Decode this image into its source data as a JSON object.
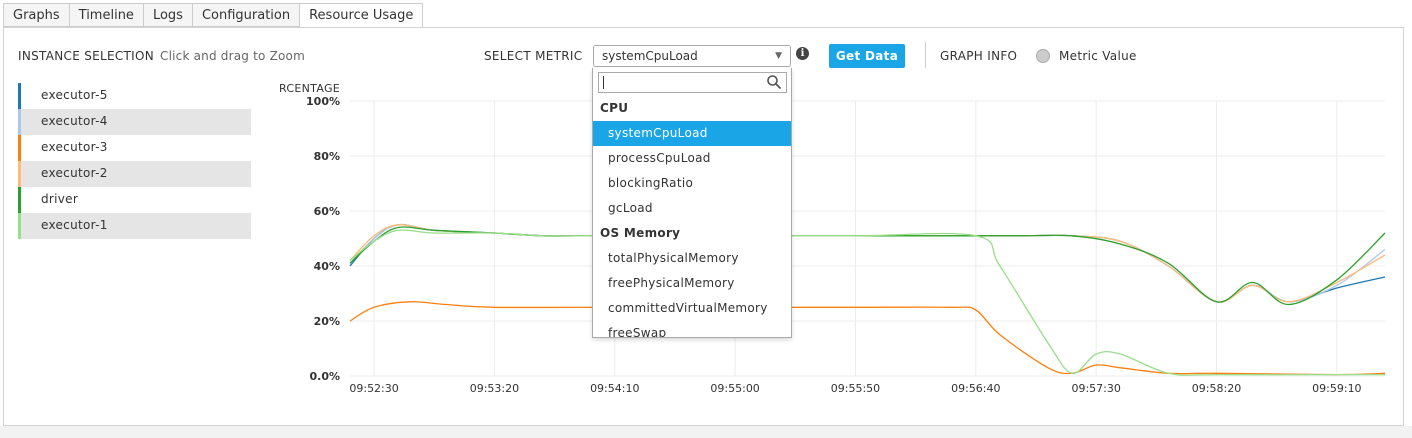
{
  "tabs": [
    {
      "label": "Graphs"
    },
    {
      "label": "Timeline"
    },
    {
      "label": "Logs"
    },
    {
      "label": "Configuration"
    },
    {
      "label": "Resource Usage",
      "active": true
    }
  ],
  "header": {
    "instance_selection_label": "INSTANCE SELECTION",
    "zoom_hint": "Click and drag to Zoom",
    "select_metric_label": "SELECT METRIC",
    "selected_metric": "systemCpuLoad",
    "get_data_label": "Get Data",
    "graph_info_label": "GRAPH INFO",
    "metric_value_label": "Metric Value"
  },
  "instances": [
    {
      "name": "executor-5",
      "color": "#1f77b4",
      "shaded": false
    },
    {
      "name": "executor-4",
      "color": "#aec7e8",
      "shaded": true
    },
    {
      "name": "executor-3",
      "color": "#ff7f0e",
      "shaded": false
    },
    {
      "name": "executor-2",
      "color": "#ffbb78",
      "shaded": true
    },
    {
      "name": "driver",
      "color": "#2ca02c",
      "shaded": false
    },
    {
      "name": "executor-1",
      "color": "#98df8a",
      "shaded": true
    }
  ],
  "dropdown": {
    "search_value": "",
    "groups": [
      {
        "label": "CPU",
        "items": [
          "systemCpuLoad",
          "processCpuLoad",
          "blockingRatio",
          "gcLoad"
        ]
      },
      {
        "label": "OS Memory",
        "items": [
          "totalPhysicalMemory",
          "freePhysicalMemory",
          "committedVirtualMemory",
          "freeSwap"
        ]
      }
    ],
    "selected_item": "systemCpuLoad"
  },
  "chart_data": {
    "type": "line",
    "ylabel": "RCENTAGE",
    "y_ticks": [
      "0.0%",
      "20%",
      "40%",
      "60%",
      "80%",
      "100%"
    ],
    "ylim": [
      0,
      100
    ],
    "x_tick_labels": [
      "09:52:30",
      "09:53:20",
      "09:54:10",
      "09:55:00",
      "09:55:50",
      "09:56:40",
      "09:57:30",
      "09:58:20",
      "09:59:10"
    ],
    "x_start": "09:52:20",
    "x_end": "09:59:30",
    "grid": true,
    "series": [
      {
        "name": "executor-5",
        "color": "#1f77b4",
        "points": [
          [
            "09:52:20",
            40
          ],
          [
            "09:52:30",
            50
          ],
          [
            "09:52:40",
            55
          ],
          [
            "09:52:55",
            53
          ],
          [
            "09:53:20",
            52
          ],
          [
            "09:53:40",
            51
          ],
          [
            "09:54:00",
            51
          ],
          [
            "09:54:20",
            51
          ],
          [
            "09:55:00",
            51
          ],
          [
            "09:55:50",
            51
          ],
          [
            "09:56:40",
            51
          ],
          [
            "09:57:00",
            51
          ],
          [
            "09:57:20",
            51
          ],
          [
            "09:57:40",
            49
          ],
          [
            "09:58:00",
            40
          ],
          [
            "09:58:20",
            27
          ],
          [
            "09:58:35",
            33
          ],
          [
            "09:58:50",
            27
          ],
          [
            "09:59:10",
            32
          ],
          [
            "09:59:30",
            36
          ]
        ]
      },
      {
        "name": "executor-4",
        "color": "#aec7e8",
        "points": [
          [
            "09:52:20",
            41
          ],
          [
            "09:52:30",
            50
          ],
          [
            "09:52:40",
            55
          ],
          [
            "09:52:55",
            53
          ],
          [
            "09:53:20",
            52
          ],
          [
            "09:53:40",
            51
          ],
          [
            "09:54:00",
            51
          ],
          [
            "09:54:20",
            51
          ],
          [
            "09:55:00",
            51
          ],
          [
            "09:55:50",
            51
          ],
          [
            "09:56:40",
            51
          ],
          [
            "09:57:00",
            51
          ],
          [
            "09:57:20",
            51
          ],
          [
            "09:57:40",
            49
          ],
          [
            "09:58:00",
            40
          ],
          [
            "09:58:20",
            27
          ],
          [
            "09:58:35",
            33
          ],
          [
            "09:58:50",
            27
          ],
          [
            "09:59:10",
            33
          ],
          [
            "09:59:30",
            46
          ]
        ]
      },
      {
        "name": "executor-3",
        "color": "#ff7f0e",
        "points": [
          [
            "09:52:20",
            20
          ],
          [
            "09:52:30",
            25
          ],
          [
            "09:52:45",
            27
          ],
          [
            "09:53:00",
            26
          ],
          [
            "09:53:20",
            25
          ],
          [
            "09:54:10",
            25
          ],
          [
            "09:55:00",
            25
          ],
          [
            "09:55:50",
            25
          ],
          [
            "09:56:30",
            25
          ],
          [
            "09:56:40",
            24
          ],
          [
            "09:56:50",
            15
          ],
          [
            "09:57:10",
            3
          ],
          [
            "09:57:20",
            1
          ],
          [
            "09:57:30",
            4
          ],
          [
            "09:57:40",
            3
          ],
          [
            "09:58:00",
            1
          ],
          [
            "09:58:20",
            1
          ],
          [
            "09:59:10",
            0.5
          ],
          [
            "09:59:30",
            1
          ]
        ]
      },
      {
        "name": "executor-2",
        "color": "#ffbb78",
        "points": [
          [
            "09:52:20",
            42
          ],
          [
            "09:52:30",
            51
          ],
          [
            "09:52:40",
            55
          ],
          [
            "09:52:55",
            53
          ],
          [
            "09:53:20",
            52
          ],
          [
            "09:53:40",
            51
          ],
          [
            "09:54:00",
            51
          ],
          [
            "09:54:20",
            51
          ],
          [
            "09:55:00",
            51
          ],
          [
            "09:55:50",
            51
          ],
          [
            "09:56:40",
            51
          ],
          [
            "09:57:00",
            51
          ],
          [
            "09:57:20",
            51
          ],
          [
            "09:57:40",
            49
          ],
          [
            "09:58:00",
            40
          ],
          [
            "09:58:20",
            27
          ],
          [
            "09:58:35",
            33
          ],
          [
            "09:58:50",
            27
          ],
          [
            "09:59:10",
            34
          ],
          [
            "09:59:30",
            44
          ]
        ]
      },
      {
        "name": "driver",
        "color": "#2ca02c",
        "points": [
          [
            "09:52:20",
            41
          ],
          [
            "09:52:30",
            49
          ],
          [
            "09:52:40",
            54
          ],
          [
            "09:52:55",
            53
          ],
          [
            "09:53:20",
            52
          ],
          [
            "09:53:40",
            51
          ],
          [
            "09:54:00",
            51
          ],
          [
            "09:54:20",
            51
          ],
          [
            "09:55:00",
            51
          ],
          [
            "09:55:50",
            51
          ],
          [
            "09:56:40",
            51
          ],
          [
            "09:57:00",
            51
          ],
          [
            "09:57:20",
            51
          ],
          [
            "09:57:40",
            48
          ],
          [
            "09:58:00",
            41
          ],
          [
            "09:58:20",
            27
          ],
          [
            "09:58:35",
            34
          ],
          [
            "09:58:50",
            26
          ],
          [
            "09:59:10",
            35
          ],
          [
            "09:59:30",
            52
          ]
        ]
      },
      {
        "name": "executor-1",
        "color": "#98df8a",
        "points": [
          [
            "09:52:20",
            42
          ],
          [
            "09:52:30",
            49
          ],
          [
            "09:52:40",
            53
          ],
          [
            "09:52:55",
            52
          ],
          [
            "09:53:20",
            52
          ],
          [
            "09:53:40",
            51
          ],
          [
            "09:54:00",
            51
          ],
          [
            "09:54:20",
            51
          ],
          [
            "09:55:00",
            51
          ],
          [
            "09:55:50",
            51
          ],
          [
            "09:56:40",
            51
          ],
          [
            "09:56:50",
            40
          ],
          [
            "09:57:10",
            12
          ],
          [
            "09:57:20",
            1
          ],
          [
            "09:57:30",
            8
          ],
          [
            "09:57:40",
            8
          ],
          [
            "09:58:00",
            1
          ],
          [
            "09:58:20",
            0.5
          ],
          [
            "09:59:10",
            0.5
          ],
          [
            "09:59:30",
            0.5
          ]
        ]
      }
    ]
  }
}
